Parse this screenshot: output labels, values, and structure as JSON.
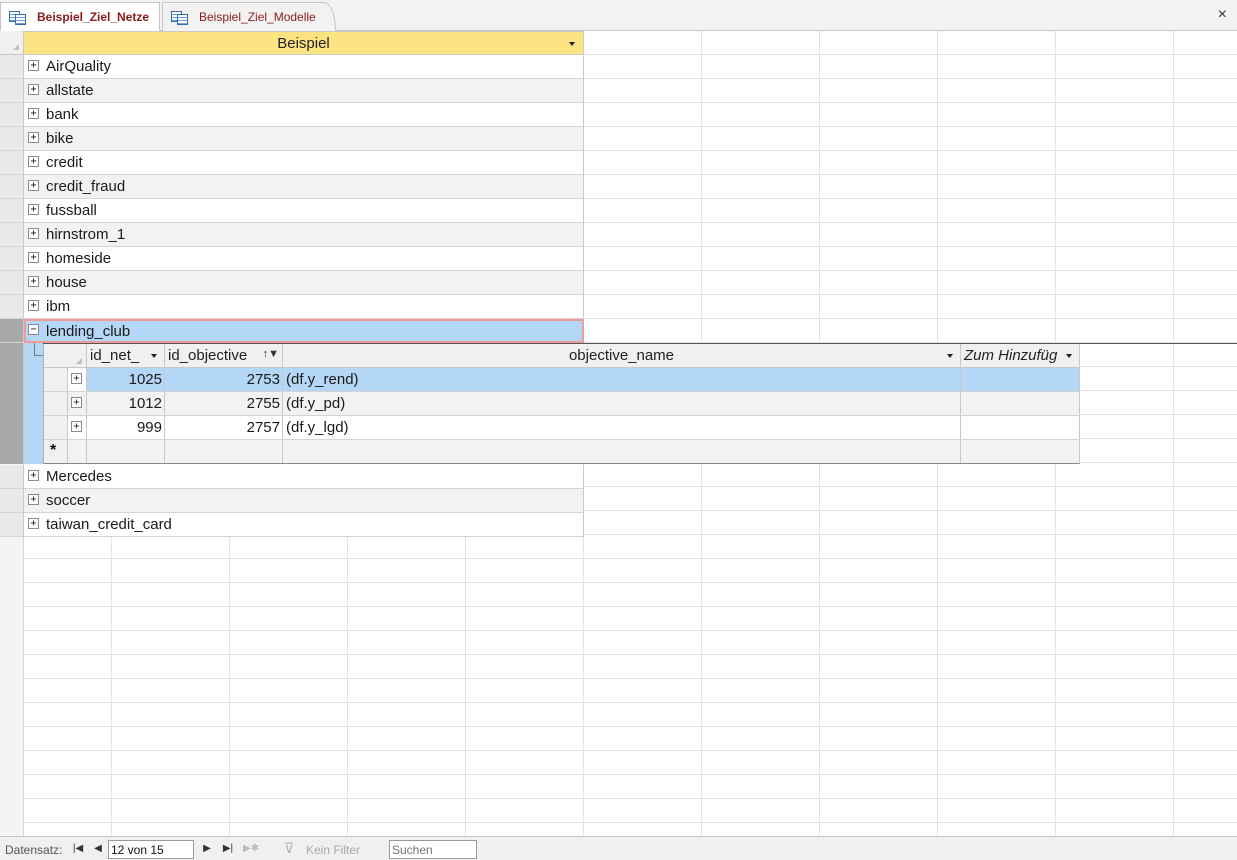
{
  "tabs": [
    {
      "label": "Beispiel_Ziel_Netze",
      "active": true,
      "icon": "table-icon"
    },
    {
      "label": "Beispiel_Ziel_Modelle",
      "active": false,
      "icon": "table-icon"
    }
  ],
  "close_symbol": "×",
  "main_table": {
    "column_header": "Beispiel",
    "rows": [
      {
        "label": "AirQuality"
      },
      {
        "label": "allstate"
      },
      {
        "label": "bank"
      },
      {
        "label": "bike"
      },
      {
        "label": "credit"
      },
      {
        "label": "credit_fraud"
      },
      {
        "label": "fussball"
      },
      {
        "label": "hirnstrom_1"
      },
      {
        "label": "homeside"
      },
      {
        "label": "house"
      },
      {
        "label": "ibm"
      },
      {
        "label": "lending_club"
      },
      {
        "label": "Mercedes"
      },
      {
        "label": "soccer"
      },
      {
        "label": "taiwan_credit_card"
      }
    ],
    "expanded_row_index": 11
  },
  "sub_table": {
    "headers": {
      "id_net": "id_net_",
      "id_objective": "id_objective",
      "objective_name": "objective_name",
      "add_column": "Zum Hinzufüg"
    },
    "rows": [
      {
        "id_net": "1025",
        "id_objective": "2753",
        "objective_name": "(df.y_rend)"
      },
      {
        "id_net": "1012",
        "id_objective": "2755",
        "objective_name": "(df.y_pd)"
      },
      {
        "id_net": "999",
        "id_objective": "2757",
        "objective_name": "(df.y_lgd)"
      }
    ],
    "new_row_symbol": "*"
  },
  "status_bar": {
    "label": "Datensatz:",
    "record_value": "12 von 15",
    "filter_label": "Kein Filter",
    "search_placeholder": "Suchen"
  },
  "colors": {
    "header_yellow": "#fde482",
    "selection_blue": "#b4d7f7",
    "active_border": "#f29a9a",
    "tab_text": "#8b1a1a"
  }
}
